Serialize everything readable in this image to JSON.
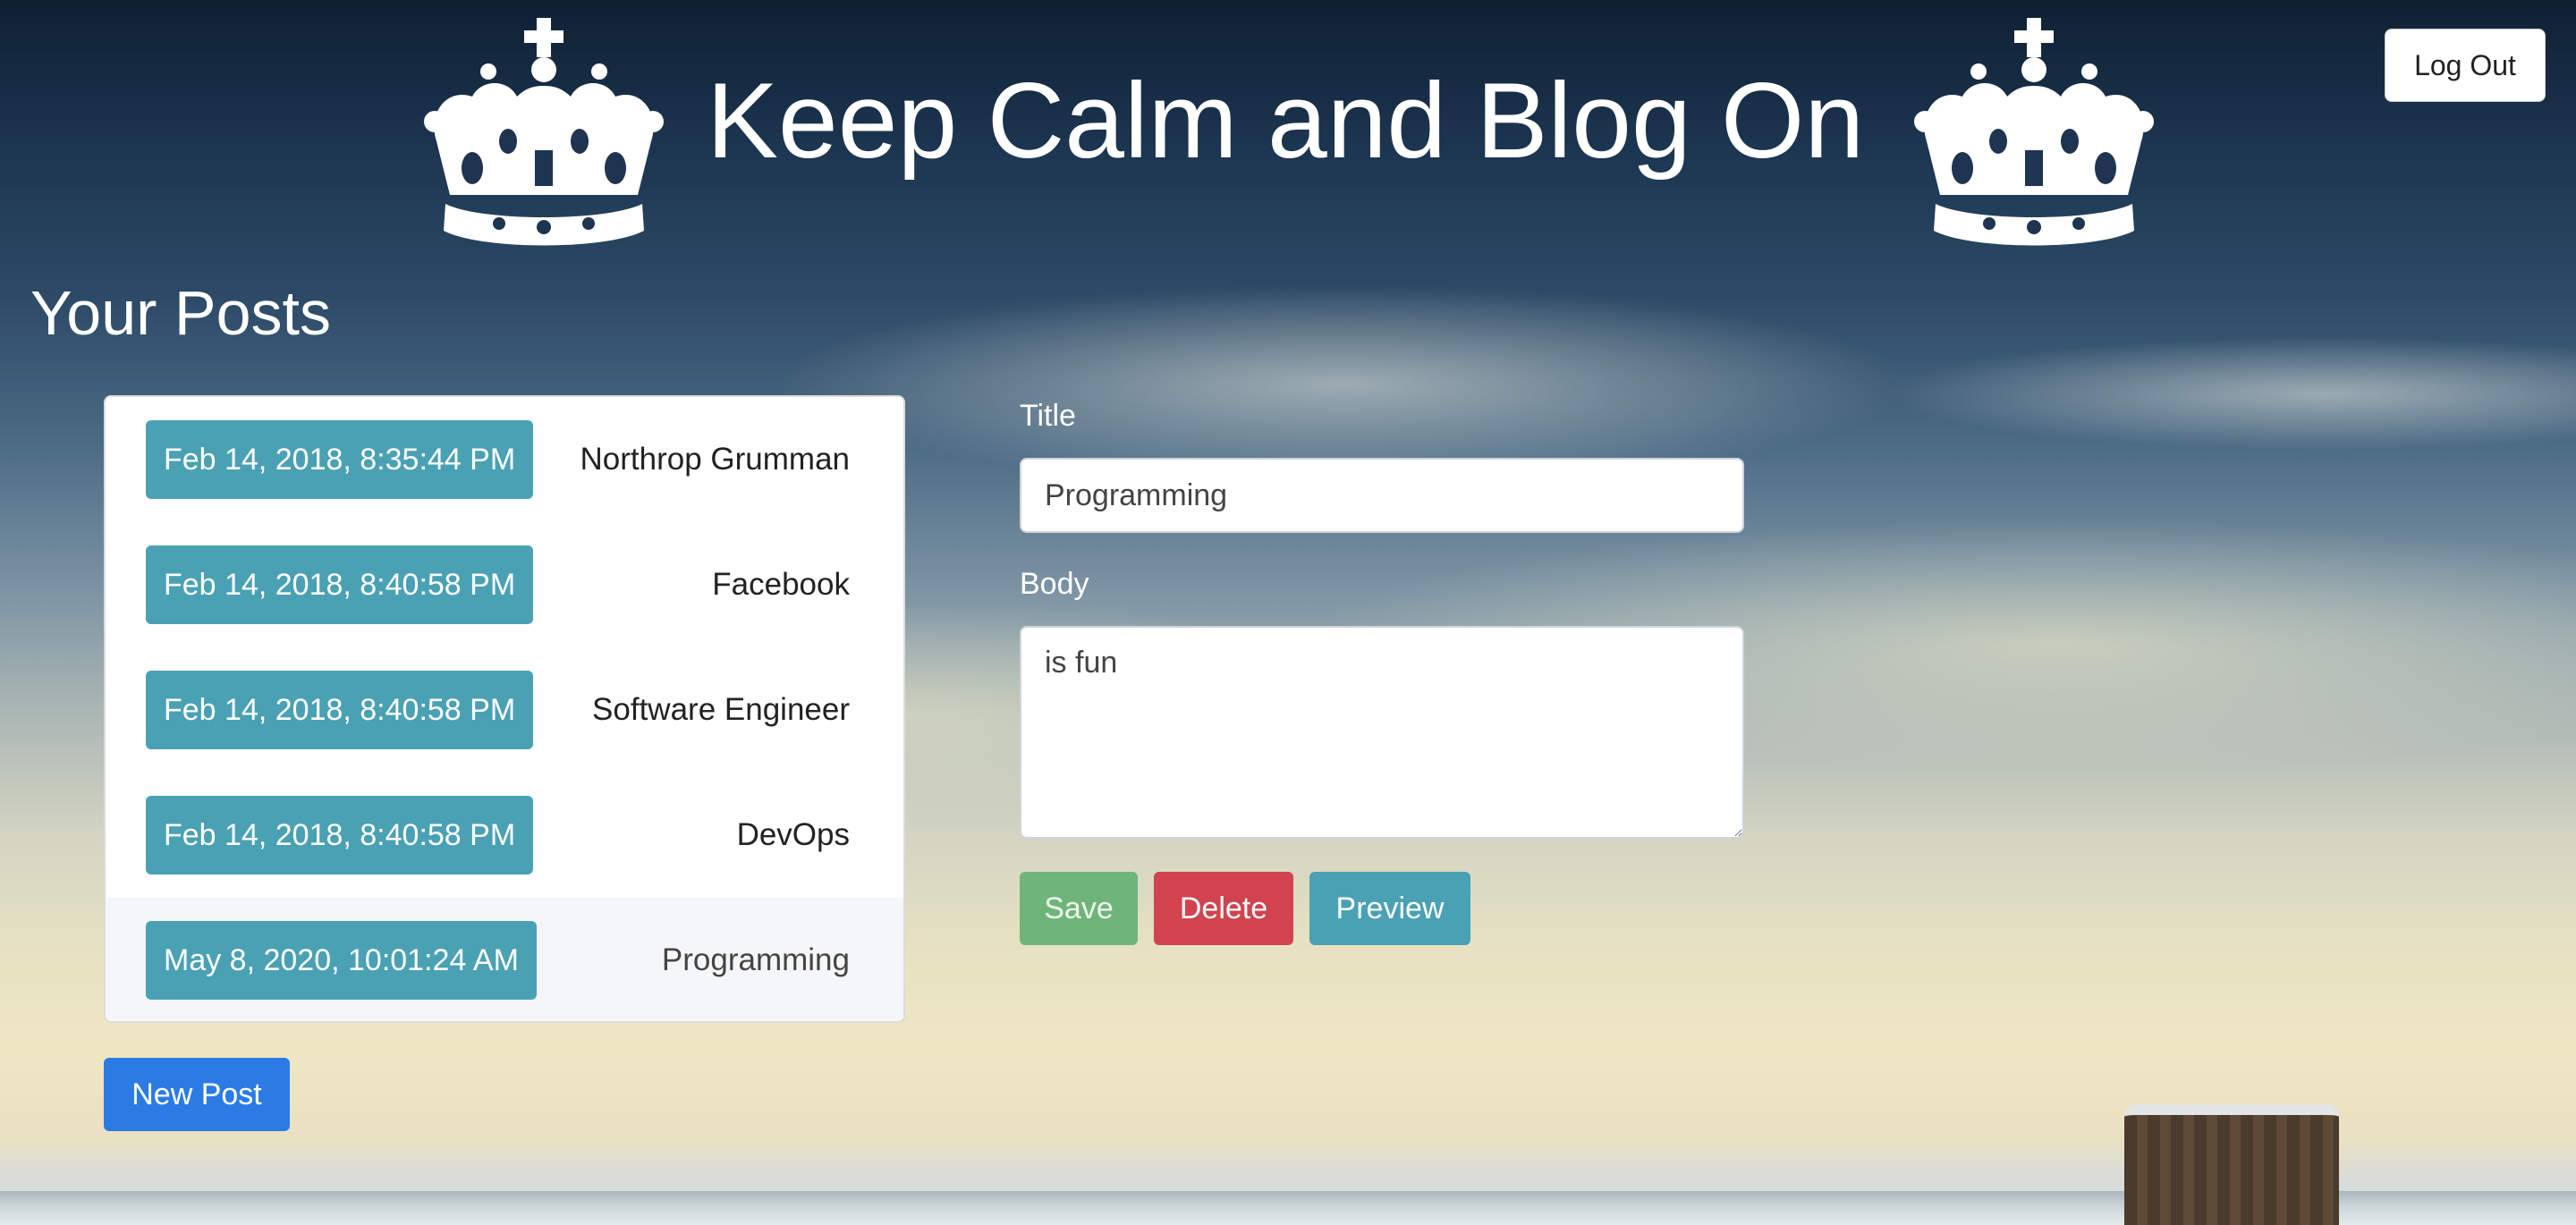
{
  "header": {
    "site_title": "Keep Calm and Blog On",
    "logout_label": "Log Out",
    "crown_icon": "crown-icon"
  },
  "posts": {
    "section_title": "Your Posts",
    "items": [
      {
        "date": "Feb 14, 2018, 8:35:44 PM",
        "title": "Northrop Grumman",
        "active": false
      },
      {
        "date": "Feb 14, 2018, 8:40:58 PM",
        "title": "Facebook",
        "active": false
      },
      {
        "date": "Feb 14, 2018, 8:40:58 PM",
        "title": "Software Engineer",
        "active": false
      },
      {
        "date": "Feb 14, 2018, 8:40:58 PM",
        "title": "DevOps",
        "active": false
      },
      {
        "date": "May 8, 2020, 10:01:24 AM",
        "title": "Programming",
        "active": true
      }
    ],
    "new_post_label": "New Post"
  },
  "editor": {
    "title_label": "Title",
    "title_value": "Programming",
    "body_label": "Body",
    "body_value": "is fun",
    "save_label": "Save",
    "delete_label": "Delete",
    "preview_label": "Preview"
  },
  "colors": {
    "date_badge": "#4aa1b4",
    "save": "#6fb57a",
    "delete": "#d0434f",
    "preview": "#4aa1b4",
    "new_post": "#2c7be5"
  }
}
